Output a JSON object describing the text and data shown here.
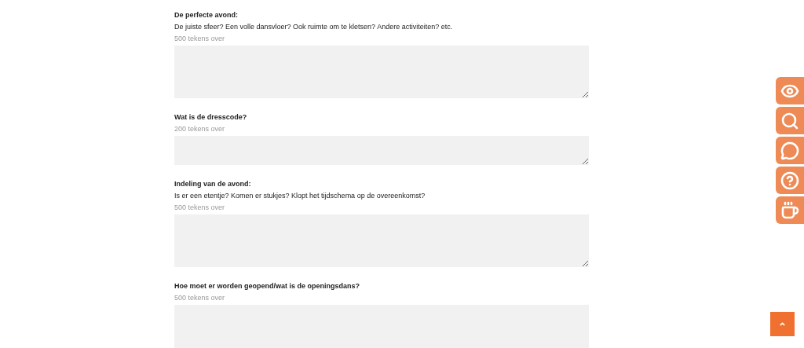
{
  "fields": [
    {
      "label": "De perfecte avond:",
      "description": "De juiste sfeer? Een volle dansvloer? Ook ruimte om te kletsen? Andere activiteiten? etc.",
      "counter": "500 tekens over",
      "kind": "large"
    },
    {
      "label": "Wat is de dresscode?",
      "counter": "200 tekens over",
      "kind": "small"
    },
    {
      "label": "Indeling van de avond:",
      "description": "Is er een etentje? Komen er stukjes? Klopt het tijdschema op de overeenkomst?",
      "counter": "500 tekens over",
      "kind": "large"
    },
    {
      "label": "Hoe moet er worden geopend/wat is de openingsdans?",
      "counter": "500 tekens over",
      "kind": "large"
    }
  ],
  "side_buttons": [
    {
      "kind": "eye"
    },
    {
      "kind": "search"
    },
    {
      "kind": "chat"
    },
    {
      "kind": "help"
    },
    {
      "kind": "cup"
    }
  ],
  "scroll_top": {
    "kind": "caret"
  }
}
